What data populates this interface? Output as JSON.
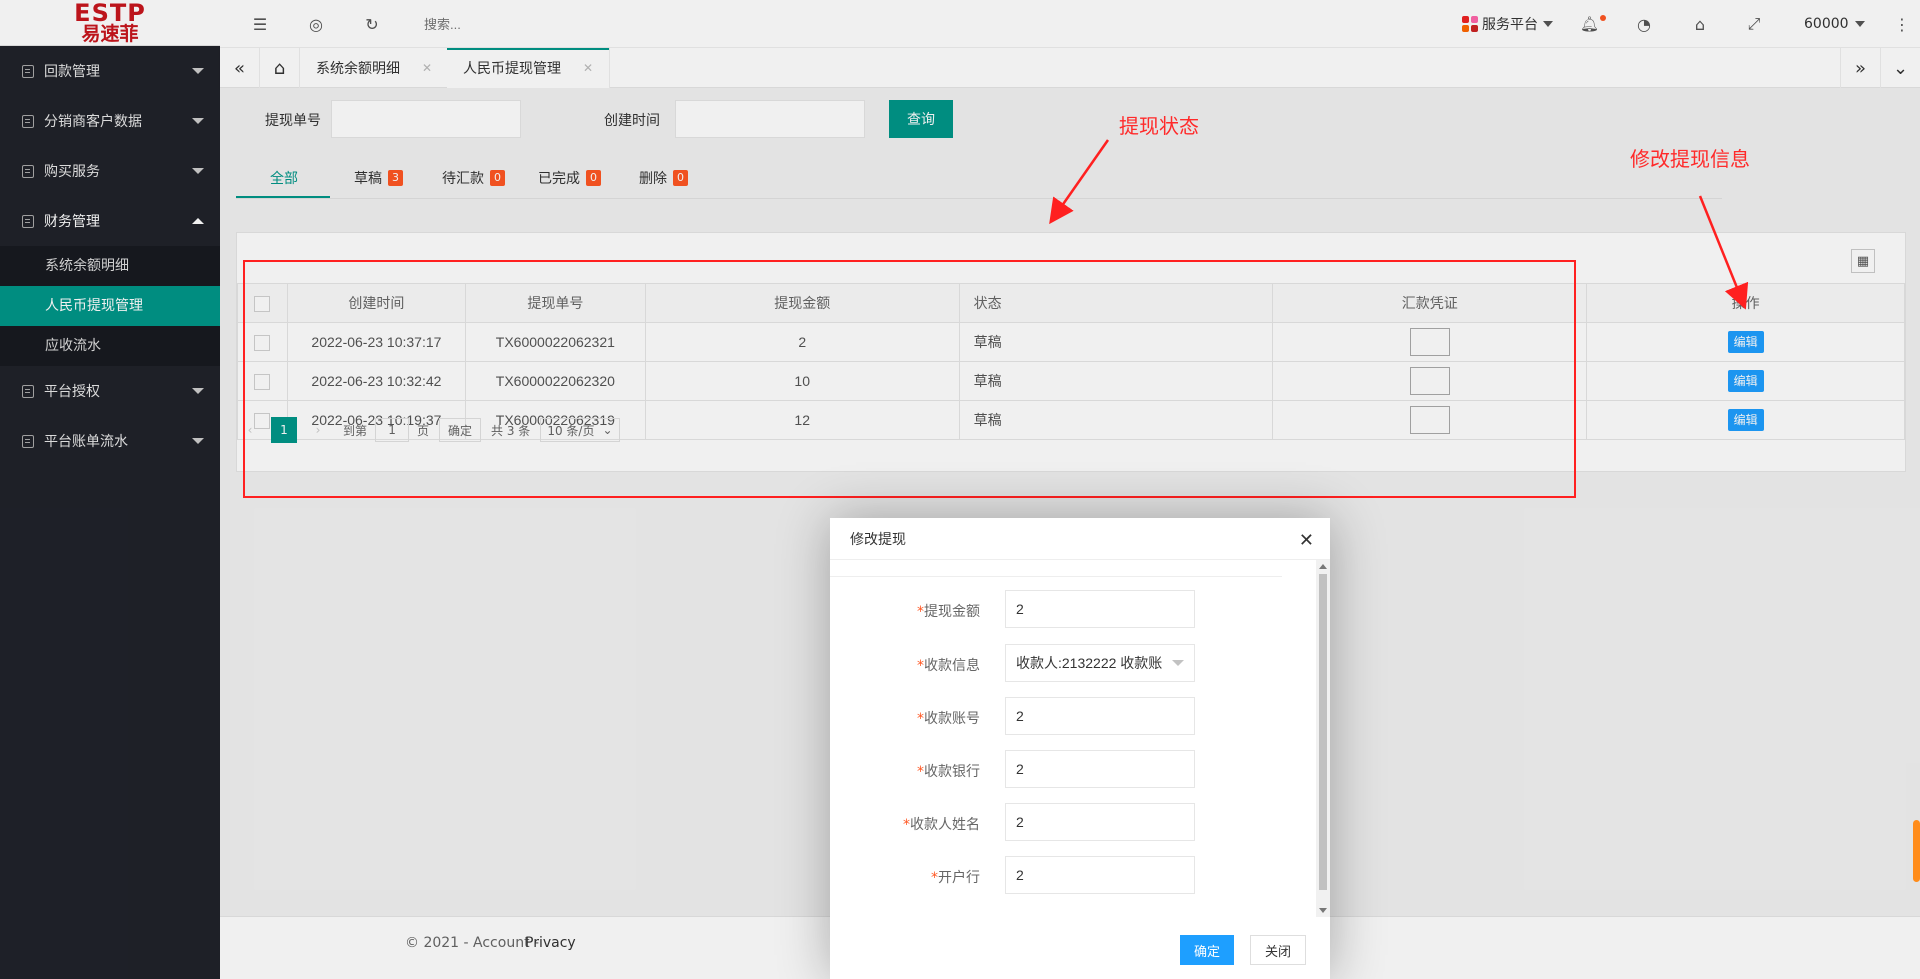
{
  "logo": {
    "line1": "ESTP",
    "line2": "易速菲"
  },
  "sidebar": {
    "items": [
      {
        "label": "回款管理"
      },
      {
        "label": "分销商客户数据"
      },
      {
        "label": "购买服务"
      },
      {
        "label": "财务管理"
      },
      {
        "label": "平台授权"
      },
      {
        "label": "平台账单流水"
      }
    ],
    "finance_sub": [
      {
        "label": "系统余额明细"
      },
      {
        "label": "人民币提现管理"
      },
      {
        "label": "应收流水"
      }
    ]
  },
  "header": {
    "search_placeholder": "搜索...",
    "platform_label": "服务平台",
    "user_label": "60000"
  },
  "tabs": [
    {
      "label": "系统余额明细"
    },
    {
      "label": "人民币提现管理"
    }
  ],
  "filters": {
    "withdraw_no_label": "提现单号",
    "created_time_label": "创建时间",
    "query_label": "查询"
  },
  "status_tabs": [
    {
      "label": "全部",
      "count": ""
    },
    {
      "label": "草稿",
      "count": "3"
    },
    {
      "label": "待汇款",
      "count": "0"
    },
    {
      "label": "已完成",
      "count": "0"
    },
    {
      "label": "删除",
      "count": "0"
    }
  ],
  "table": {
    "columns": [
      "创建时间",
      "提现单号",
      "提现金额",
      "状态",
      "汇款凭证",
      "操作"
    ],
    "rows": [
      {
        "created": "2022-06-23 10:37:17",
        "no": "TX6000022062321",
        "amount": "2",
        "status": "草稿",
        "action": "编辑"
      },
      {
        "created": "2022-06-23 10:32:42",
        "no": "TX6000022062320",
        "amount": "10",
        "status": "草稿",
        "action": "编辑"
      },
      {
        "created": "2022-06-23 10:19:37",
        "no": "TX6000022062319",
        "amount": "12",
        "status": "草稿",
        "action": "编辑"
      }
    ]
  },
  "pager": {
    "current": "1",
    "goto_label": "到第",
    "page_input": "1",
    "page_label": "页",
    "confirm_label": "确定",
    "total_label": "共 3 条",
    "page_size": "10 条/页"
  },
  "footer": {
    "copyright": "© 2021 - Account - ",
    "privacy": "Privacy"
  },
  "annotations": {
    "status_note": "提现状态",
    "edit_note": "修改提现信息"
  },
  "modal": {
    "title": "修改提现",
    "fields": [
      {
        "label": "提现金额",
        "value": "2"
      },
      {
        "label": "收款信息",
        "value": "收款人:2132222 收款账"
      },
      {
        "label": "收款账号",
        "value": "2"
      },
      {
        "label": "收款银行",
        "value": "2"
      },
      {
        "label": "收款人姓名",
        "value": "2"
      },
      {
        "label": "开户行",
        "value": "2"
      }
    ],
    "ok_label": "确定",
    "close_label": "关闭"
  }
}
